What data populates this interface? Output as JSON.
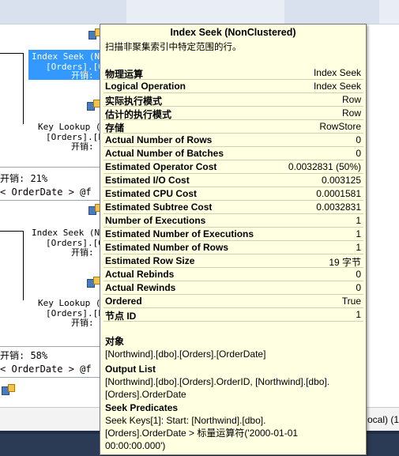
{
  "plan": {
    "upper": {
      "index_seek_lines": [
        "Index Seek (N",
        "[Orders].[O",
        "开销:"
      ],
      "key_lookup_lines": [
        "Key Lookup (",
        "[Orders].[P",
        "开销:"
      ],
      "cost_line": "开销: 21%",
      "where_line": "< OrderDate > @f"
    },
    "lower": {
      "index_seek_lines": [
        "Index Seek (N",
        "[Orders].[O",
        "开销:"
      ],
      "key_lookup_lines": [
        "Key Lookup (",
        "[Orders].[P",
        "开销:"
      ],
      "cost_line": "开销: 58%",
      "where_line": "< OrderDate > @f"
    }
  },
  "status_bar": {
    "connection_fragment": "ocal) (1"
  },
  "tooltip": {
    "title": "Index Seek (NonClustered)",
    "subtitle": "扫描非聚集索引中特定范围的行。",
    "properties": [
      {
        "label": "物理运算",
        "value": "Index Seek"
      },
      {
        "label": "Logical Operation",
        "value": "Index Seek"
      },
      {
        "label": "实际执行模式",
        "value": "Row"
      },
      {
        "label": "估计的执行模式",
        "value": "Row"
      },
      {
        "label": "存储",
        "value": "RowStore"
      },
      {
        "label": "Actual Number of Rows",
        "value": "0"
      },
      {
        "label": "Actual Number of Batches",
        "value": "0"
      },
      {
        "label": "Estimated Operator Cost",
        "value": "0.0032831 (50%)"
      },
      {
        "label": "Estimated I/O Cost",
        "value": "0.003125"
      },
      {
        "label": "Estimated CPU Cost",
        "value": "0.0001581"
      },
      {
        "label": "Estimated Subtree Cost",
        "value": "0.0032831"
      },
      {
        "label": "Number of Executions",
        "value": "1"
      },
      {
        "label": "Estimated Number of Executions",
        "value": "1"
      },
      {
        "label": "Estimated Number of Rows",
        "value": "1"
      },
      {
        "label": "Estimated Row Size",
        "value": "19 字节"
      },
      {
        "label": "Actual Rebinds",
        "value": "0"
      },
      {
        "label": "Actual Rewinds",
        "value": "0"
      },
      {
        "label": "Ordered",
        "value": "True"
      },
      {
        "label": "节点 ID",
        "value": "1"
      }
    ],
    "object": {
      "heading": "对象",
      "text": "[Northwind].[dbo].[Orders].[OrderDate]"
    },
    "output_list": {
      "heading": "Output List",
      "lines": [
        "[Northwind].[dbo].[Orders].OrderID, [Northwind].[dbo].",
        "[Orders].OrderDate"
      ]
    },
    "seek_predicates": {
      "heading": "Seek Predicates",
      "lines": [
        "Seek Keys[1]: Start: [Northwind].[dbo].",
        "[Orders].OrderDate > 标量运算符('2000-01-01",
        "00:00:00.000')"
      ]
    }
  }
}
